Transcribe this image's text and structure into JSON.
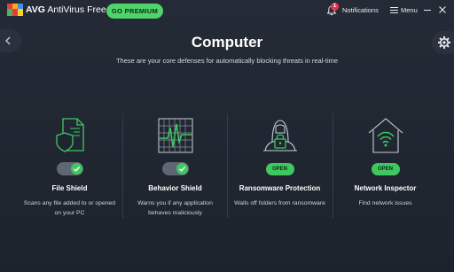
{
  "app": {
    "brand_bold": "AVG",
    "brand_rest": " AntiVirus Free",
    "premium_label": "GO PREMIUM",
    "notifications_label": "Notifications",
    "notifications_count": "1",
    "menu_label": "Menu"
  },
  "page": {
    "title": "Computer",
    "subtitle": "These are your core defenses for automatically blocking threats in real-time"
  },
  "cards": [
    {
      "title": "File Shield",
      "description": "Scans any file added to or opened on your PC",
      "control": "toggle",
      "enabled": true,
      "icon": "file-shield-icon"
    },
    {
      "title": "Behavior Shield",
      "description": "Warns you if any application behaves maliciously",
      "control": "toggle",
      "enabled": true,
      "icon": "behavior-monitor-icon"
    },
    {
      "title": "Ransomware Protection",
      "description": "Walls off folders from ransomware",
      "control": "button",
      "button_label": "OPEN",
      "icon": "ransomware-lock-icon"
    },
    {
      "title": "Network Inspector",
      "description": "Find network issues",
      "control": "button",
      "button_label": "OPEN",
      "icon": "network-house-icon"
    }
  ],
  "colors": {
    "accent_green": "#3fc860",
    "background": "#1f2530",
    "badge_red": "#e8374b"
  }
}
